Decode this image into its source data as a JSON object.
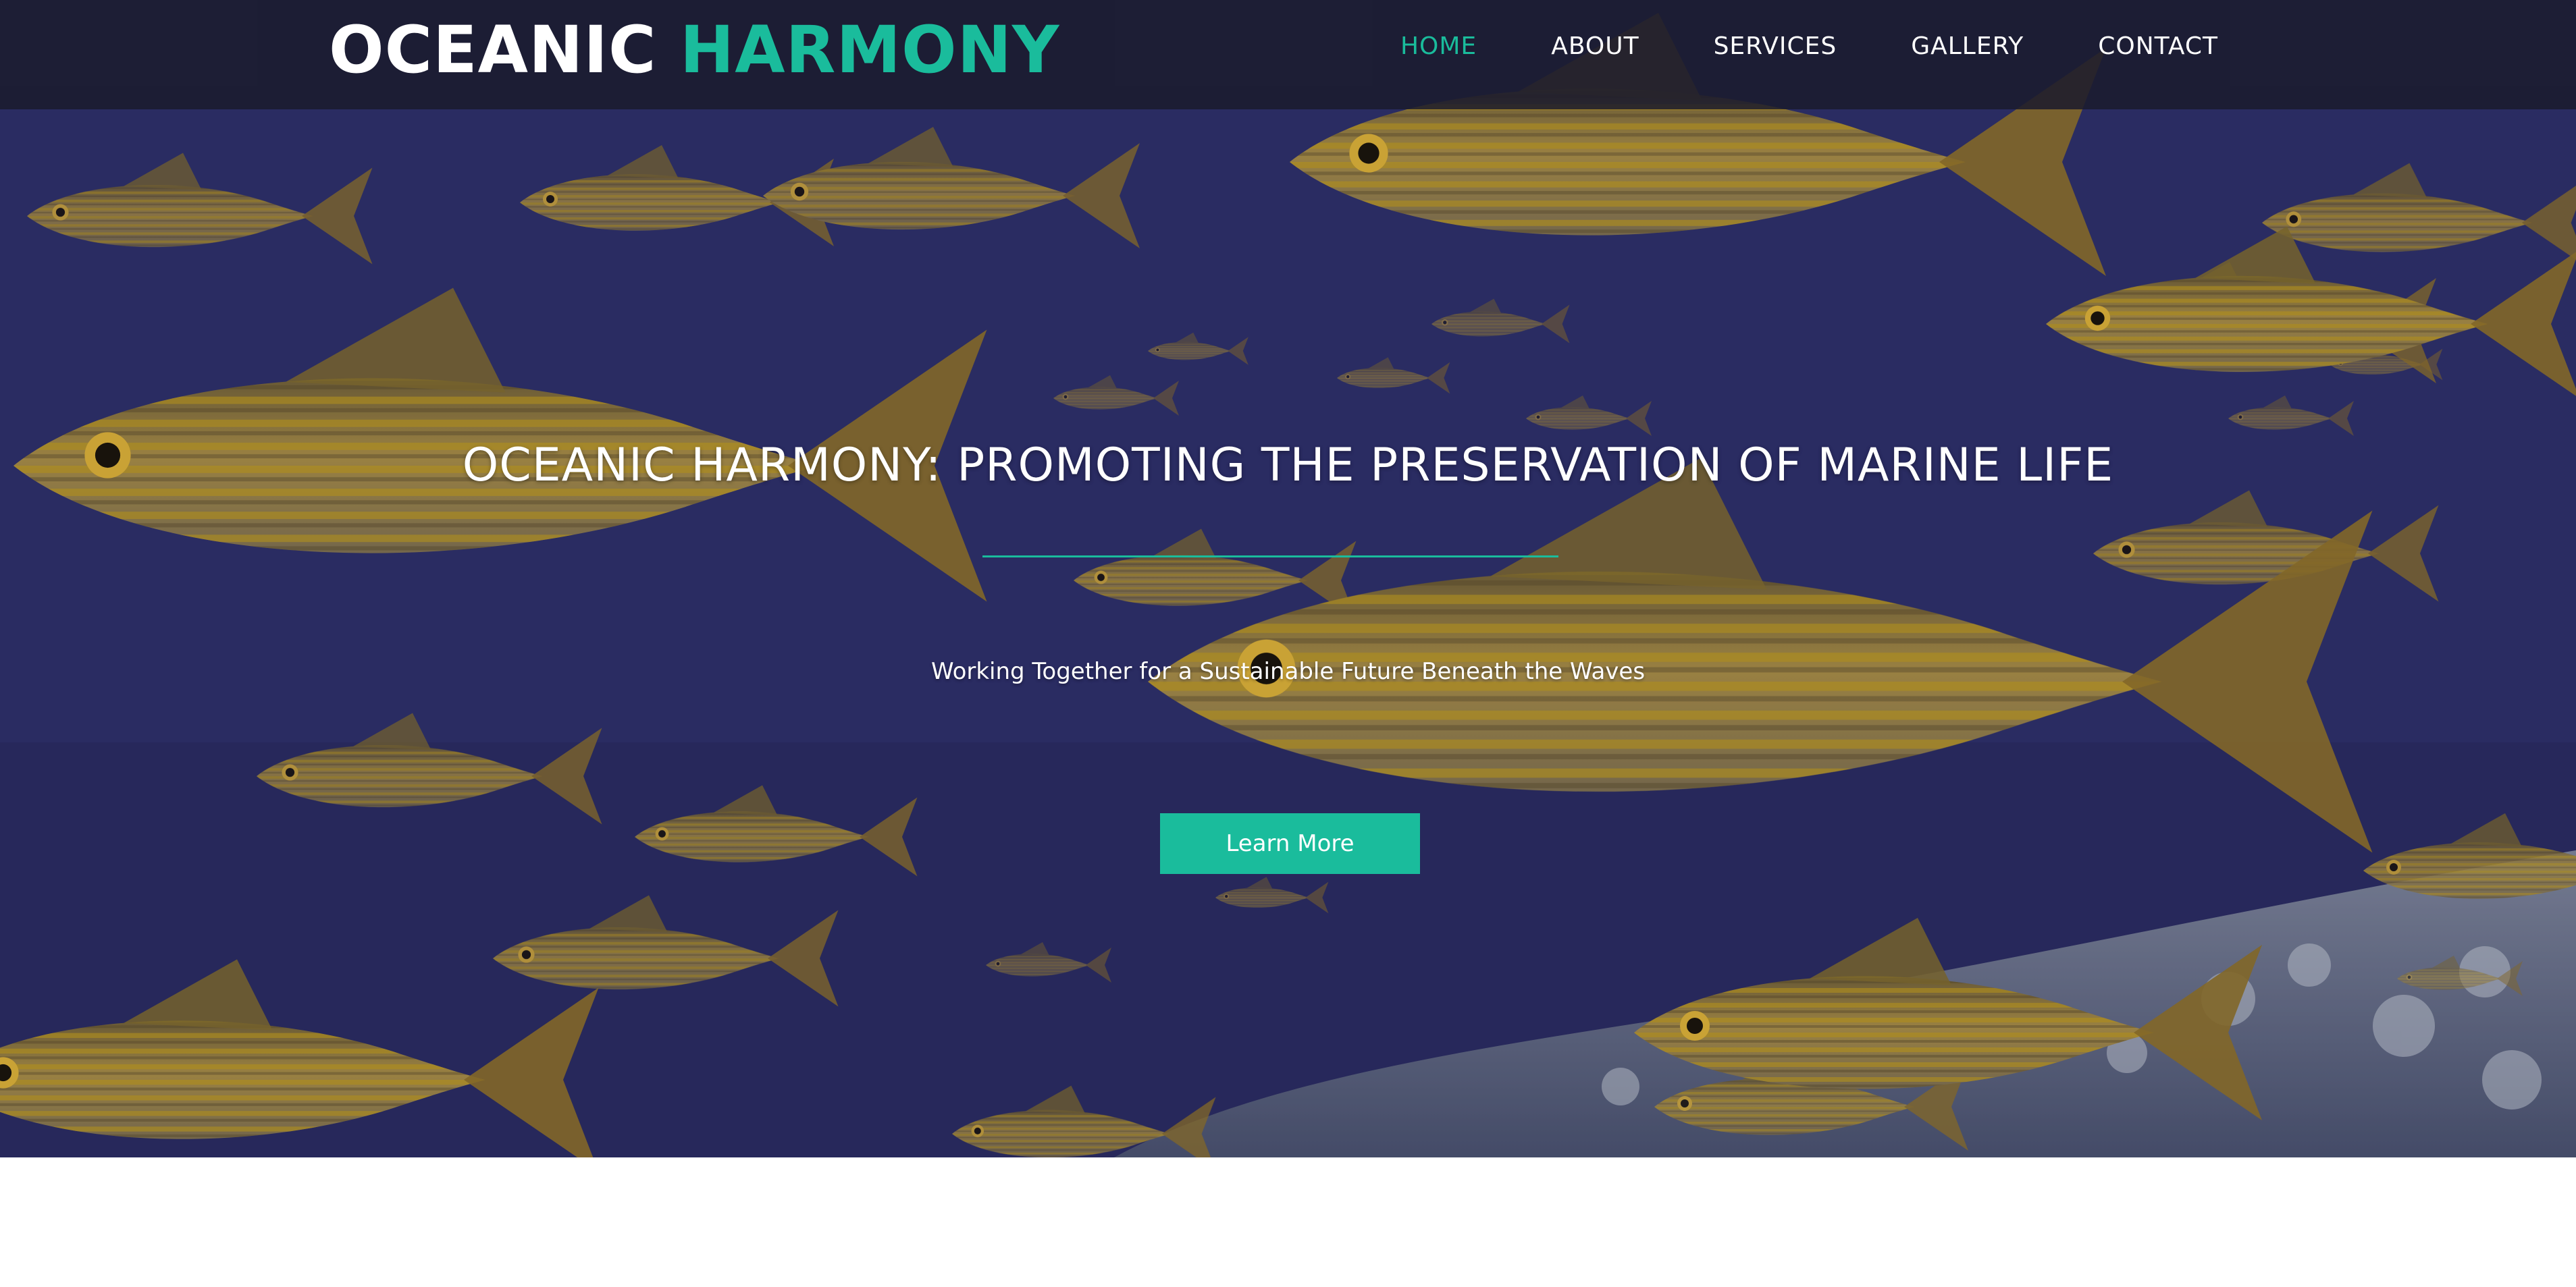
{
  "brand": {
    "first": "OCEANIC",
    "second": "HARMONY"
  },
  "nav": {
    "items": [
      {
        "label": "HOME",
        "active": true
      },
      {
        "label": "ABOUT",
        "active": false
      },
      {
        "label": "SERVICES",
        "active": false
      },
      {
        "label": "GALLERY",
        "active": false
      },
      {
        "label": "CONTACT",
        "active": false
      }
    ]
  },
  "hero": {
    "title": "OCEANIC HARMONY: PROMOTING THE PRESERVATION OF MARINE LIFE",
    "subtitle": "Working Together for a Sustainable Future Beneath the Waves",
    "cta_label": "Learn More",
    "background_icon": "school-of-fish-photo"
  },
  "colors": {
    "accent": "#1abc9c",
    "navbar": "#1b1b2d",
    "ocean": "#2d2f6b",
    "fish_yellow": "#c89a1c",
    "text": "#ffffff"
  }
}
